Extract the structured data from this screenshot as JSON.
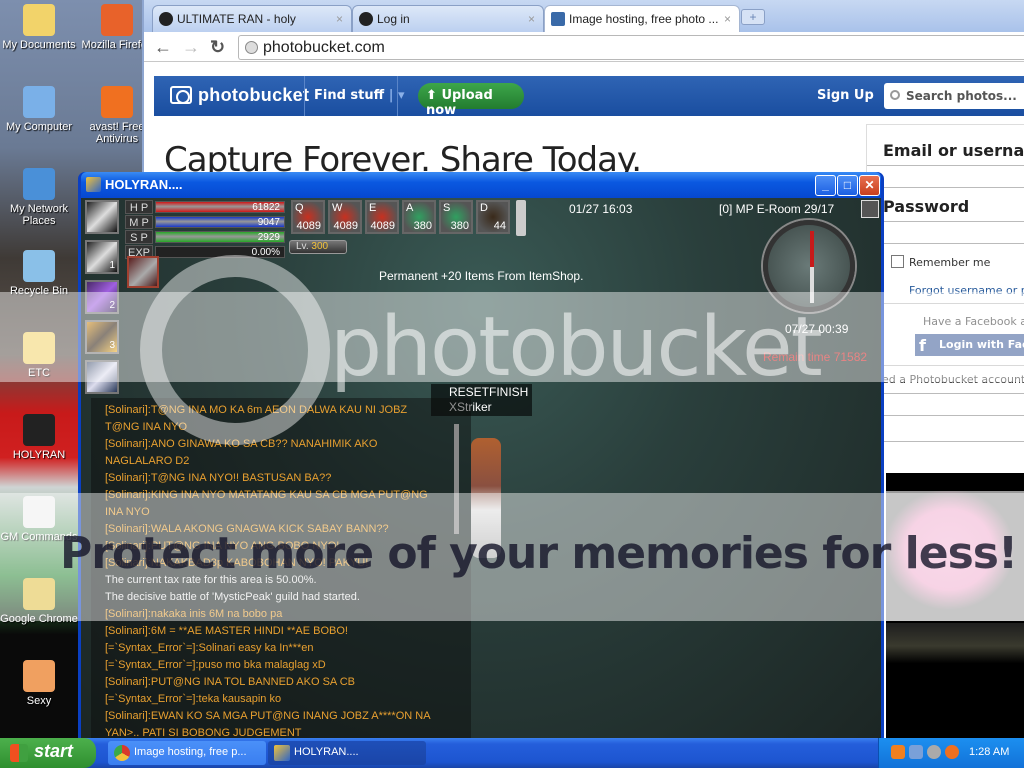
{
  "desktop": {
    "icons": [
      {
        "label": "My Documents",
        "icon": "folder-documents-icon"
      },
      {
        "label": "Mozilla Firefox",
        "icon": "firefox-icon"
      },
      {
        "label": "My Computer",
        "icon": "computer-icon"
      },
      {
        "label": "avast! Free Antivirus",
        "icon": "avast-icon"
      },
      {
        "label": "My Network Places",
        "icon": "network-icon"
      },
      {
        "label": "Recycle Bin",
        "icon": "recycle-bin-icon"
      },
      {
        "label": "ETC",
        "icon": "folder-icon"
      },
      {
        "label": "HOLYRAN",
        "icon": "holyran-icon"
      },
      {
        "label": "GM Commands",
        "icon": "text-document-icon"
      },
      {
        "label": "Google Chrome",
        "icon": "chrome-icon"
      },
      {
        "label": "Sexy",
        "icon": "image-file-icon"
      }
    ]
  },
  "browser": {
    "tabs": [
      {
        "label": "ULTIMATE RAN - holy",
        "active": false
      },
      {
        "label": "Log in",
        "active": false
      },
      {
        "label": "Image hosting, free photo ...",
        "active": true
      }
    ],
    "address": "photobucket.com",
    "page": {
      "brand": "photobucket",
      "find_stuff": "Find stuff",
      "upload": "Upload now",
      "signup": "Sign Up",
      "search_placeholder": "Search photos...",
      "headline": "Capture Forever. Share Today.",
      "login": {
        "email_label": "Email or username",
        "password_label": "Password",
        "remember": "Remember me",
        "forgot": "Forgot username or password?",
        "facebook_prompt": "Have a Facebook account?",
        "facebook_button": "Login with Facebook",
        "need_account": "Need a Photobucket account?"
      }
    }
  },
  "watermark": {
    "logo": "photobucket",
    "tagline": "Protect more of your memories for less!"
  },
  "game": {
    "title": "HOLYRAN....",
    "skills": [
      "",
      "1",
      "2",
      "3",
      ""
    ],
    "bars": [
      {
        "label": "H P",
        "value": "61822",
        "fill": 1.0,
        "color": "#d01818"
      },
      {
        "label": "M P",
        "value": "9047",
        "fill": 1.0,
        "color": "#1838c8"
      },
      {
        "label": "S P",
        "value": "2929",
        "fill": 1.0,
        "color": "#28a828"
      },
      {
        "label": "EXP",
        "value": "0.00%",
        "fill": 0.0,
        "color": "#888888"
      }
    ],
    "level_label": "Lv.",
    "level": "300",
    "quickslots": [
      {
        "key": "Q",
        "count": "4089"
      },
      {
        "key": "W",
        "count": "4089"
      },
      {
        "key": "E",
        "count": "4089"
      },
      {
        "key": "A",
        "count": "380"
      },
      {
        "key": "S",
        "count": "380"
      },
      {
        "key": "D",
        "count": "44"
      }
    ],
    "datetime": "01/27 16:03",
    "room": "[0]  MP E-Room 29/17",
    "notice": "Permanent +20 Items From ItemShop.",
    "map_time": "07/27 00:39",
    "remain_time": "Remain time 71582",
    "nameplate": [
      "RESETFINISH",
      "XStriker"
    ],
    "chat": [
      {
        "text": "[Solinari]:T@NG INA MO KA 6m AEON DALWA KAU NI JOBZ",
        "sys": false
      },
      {
        "text": " T@NG INA NYO",
        "sys": false
      },
      {
        "text": "[Solinari]:ANO GINAWA KO SA CB?? NANAHIMIK AKO",
        "sys": false
      },
      {
        "text": " NAGLALARO D2",
        "sys": false
      },
      {
        "text": "[Solinari]:T@NG INA NYO!! BASTUSAN BA??",
        "sys": false
      },
      {
        "text": "[Solinari]:KING INA NYO MATATANG KAU SA CB MGA PUT@NG",
        "sys": false
      },
      {
        "text": " INA NYO",
        "sys": false
      },
      {
        "text": "[Solinari]:WALA AKONG GNAGWA KICK SABAY BANN??",
        "sys": false
      },
      {
        "text": "[Solinari]:PUT@NG INA NYO ANG BOBO NYO!",
        "sys": false
      },
      {
        "text": "[Solinari]:NAKAKBAD3p KABOBOHAN NYO! PAKYU!",
        "sys": false
      },
      {
        "text": "The current tax rate for this area is 50.00%.",
        "sys": true
      },
      {
        "text": "The decisive battle of 'MysticPeak' guild had started.",
        "sys": true
      },
      {
        "text": "[Solinari]:nakaka inis 6M na bobo pa",
        "sys": false
      },
      {
        "text": "[Solinari]:6M = **AE MASTER HINDI **AE BOBO!",
        "sys": false
      },
      {
        "text": "[=`Syntax_Error`=]:Solinari easy ka In***en",
        "sys": false
      },
      {
        "text": "[=`Syntax_Error`=]:puso mo bka malaglag xD",
        "sys": false
      },
      {
        "text": "[Solinari]:PUT@NG INA TOL BANNED AKO SA CB",
        "sys": false
      },
      {
        "text": "[=`Syntax_Error`=]:teka kausapin ko",
        "sys": false
      },
      {
        "text": "[Solinari]:EWAN KO SA MGA PUT@NG INANG JOBZ A****ON NA",
        "sys": false
      },
      {
        "text": " YAN>.. PATI SI BOBONG JUDGEMENT",
        "sys": false
      }
    ]
  },
  "taskbar": {
    "start": "start",
    "buttons": [
      {
        "label": "Image hosting, free p...",
        "icon": "chrome-icon"
      },
      {
        "label": "HOLYRAN....",
        "icon": "holyran-icon"
      }
    ],
    "clock": "1:28 AM"
  }
}
